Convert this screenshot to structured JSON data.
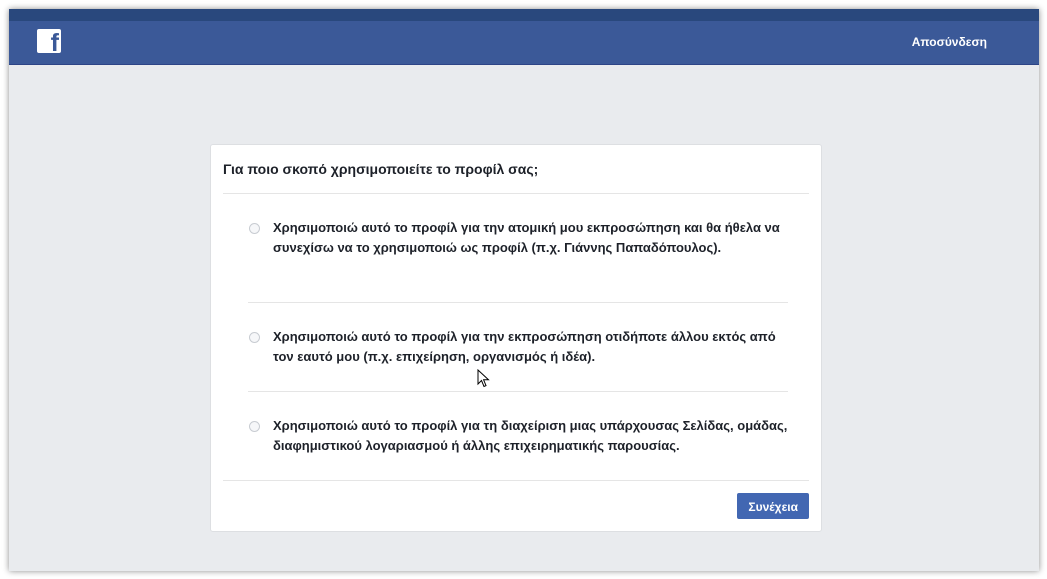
{
  "header": {
    "logo_letter": "f",
    "logout_label": "Αποσύνδεση"
  },
  "dialog": {
    "question": "Για ποιο σκοπό χρησιμοποιείτε το προφίλ σας;",
    "options": [
      {
        "label": "Χρησιμοποιώ αυτό το προφίλ για την ατομική μου εκπροσώπηση και θα ήθελα να συνεχίσω να το χρησιμοποιώ ως προφίλ (π.χ. Γιάννης Παπαδόπουλος)."
      },
      {
        "label": "Χρησιμοποιώ αυτό το προφίλ για την εκπροσώπηση οτιδήποτε άλλου εκτός από τον εαυτό μου (π.χ. επιχείρηση, οργανισμός ή ιδέα)."
      },
      {
        "label": "Χρησιμοποιώ αυτό το προφίλ για τη διαχείριση μιας υπάρχουσας Σελίδας, ομάδας, διαφημιστικού λογαριασμού ή άλλης επιχειρηματικής παρουσίας."
      }
    ],
    "continue_label": "Συνέχεια"
  },
  "colors": {
    "brand_blue": "#3b5998",
    "button_blue": "#4267b2",
    "page_bg": "#e9ebee"
  }
}
